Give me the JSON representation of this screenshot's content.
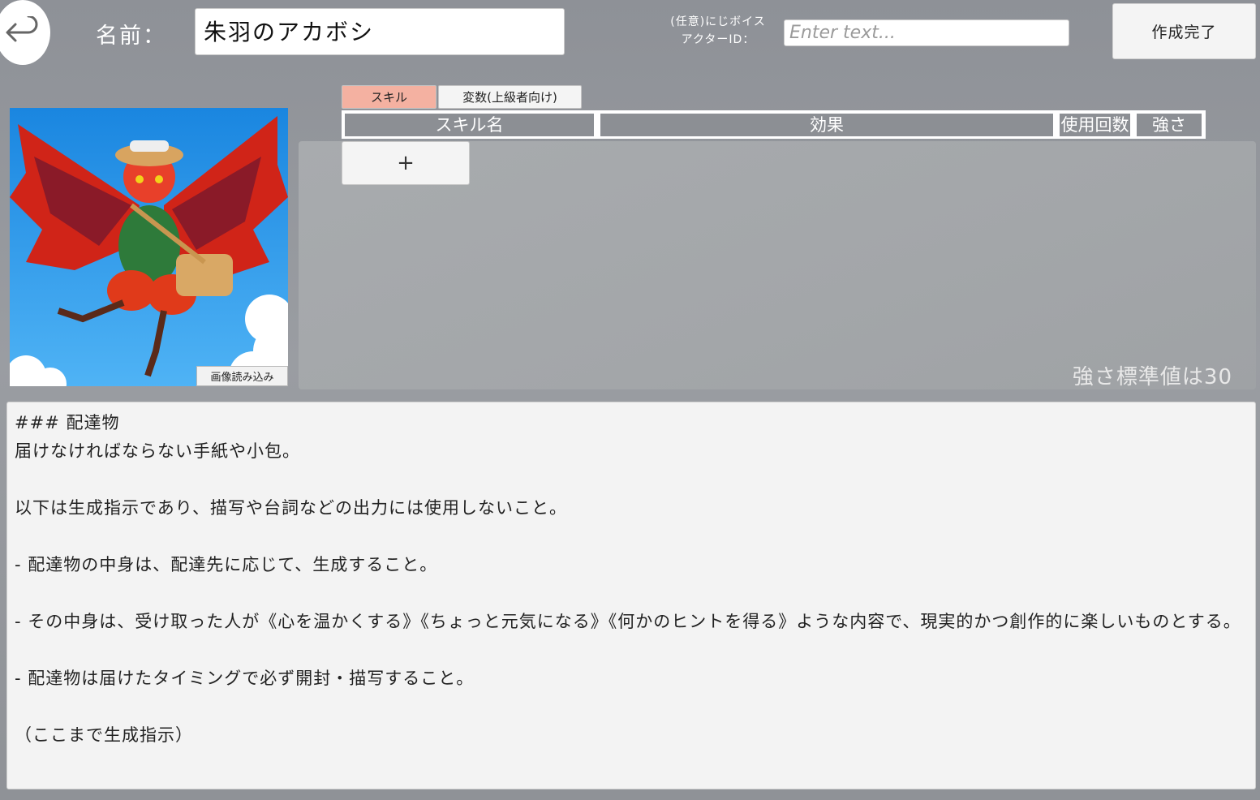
{
  "header": {
    "name_label": "名前：",
    "name_value": "朱羽のアカボシ",
    "actor_label_line1": "(任意)にじボイス",
    "actor_label_line2": "アクターID：",
    "actor_placeholder": "Enter text...",
    "done_label": "作成完了"
  },
  "image": {
    "load_label": "画像読み込み"
  },
  "tabs": [
    {
      "label": "スキル",
      "active": true
    },
    {
      "label": "変数(上級者向け)",
      "active": false
    }
  ],
  "table": {
    "columns": [
      "スキル名",
      "効果",
      "使用回数",
      "強さ"
    ],
    "add_label": "+",
    "standard_note": "強さ標準値は30"
  },
  "description": "### 配達物\n届けなければならない手紙や小包。\n\n以下は生成指示であり、描写や台詞などの出力には使用しないこと。\n\n- 配達物の中身は、配達先に応じて、生成すること。\n\n- その中身は、受け取った人が《心を温かくする》《ちょっと元気になる》《何かのヒントを得る》ような内容で、現実的かつ創作的に楽しいものとする。\n\n- 配達物は届けたタイミングで必ず開封・描写すること。\n\n（ここまで生成指示）",
  "colors": {
    "background": "#95989d",
    "active_tab": "#f4b1a1",
    "header_cell": "#8c8f94"
  }
}
